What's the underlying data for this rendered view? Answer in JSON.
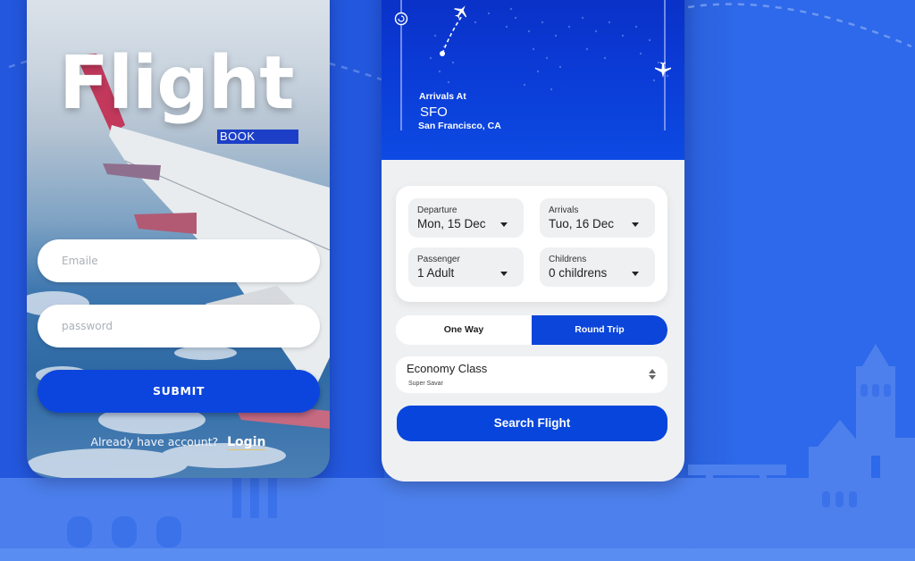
{
  "colors": {
    "background": "#2c66e8",
    "primary": "#0c45dd",
    "header_blue": "#0a2fc4",
    "login_underline": "#e2c36a"
  },
  "login_screen": {
    "logo_title": "Flight",
    "logo_subtitle": "BOOK",
    "email_placeholder": "Emaile",
    "password_placeholder": "password",
    "submit_label": "SUBMIT",
    "account_prompt": "Already have account?",
    "login_link": "Login"
  },
  "search_screen": {
    "header": {
      "icons": [
        "refresh-icon",
        "airplane-icon",
        "airplane-icon"
      ],
      "arrivals_label": "Arrivals At",
      "airport_code": "SFO",
      "city": "San Francisco, CA"
    },
    "selectors": [
      {
        "label": "Departure",
        "value": "Mon, 15 Dec"
      },
      {
        "label": "Arrivals",
        "value": "Tuo, 16 Dec"
      },
      {
        "label": "Passenger",
        "value": "1 Adult"
      },
      {
        "label": "Childrens",
        "value": "0 childrens"
      }
    ],
    "trip_type": {
      "options": [
        "One Way",
        "Round Trip"
      ],
      "selected": "Round Trip"
    },
    "class_select": {
      "value": "Economy Class",
      "subtitle": "Super Savar"
    },
    "search_button": "Search Flight"
  }
}
